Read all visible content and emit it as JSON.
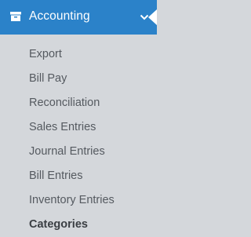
{
  "sidebar": {
    "section": {
      "title": "Accounting",
      "icon": "archive-box-icon",
      "expand_icon": "chevron-down-icon",
      "colors": {
        "header_bg": "#2b82c9",
        "header_text": "#ffffff",
        "panel_bg": "#d4d7db"
      }
    },
    "items": [
      {
        "label": "Export"
      },
      {
        "label": "Bill Pay"
      },
      {
        "label": "Reconciliation"
      },
      {
        "label": "Sales Entries"
      },
      {
        "label": "Journal Entries"
      },
      {
        "label": "Bill Entries"
      },
      {
        "label": "Inventory Entries"
      },
      {
        "label": "Categories",
        "active": true
      }
    ]
  }
}
